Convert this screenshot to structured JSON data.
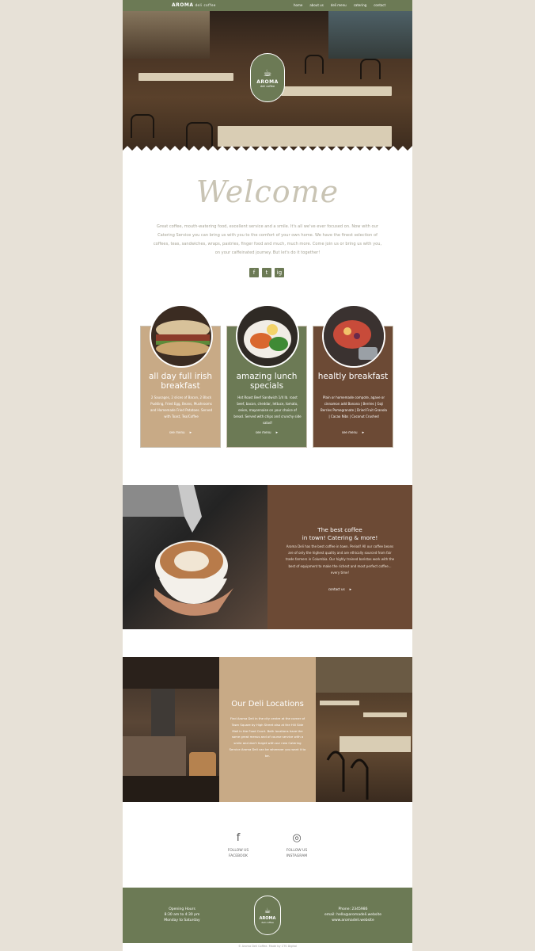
{
  "nav": {
    "brand": "AROMA",
    "brand_sub": "deli coffee",
    "links": [
      "home",
      "about us",
      "deli menu",
      "catering",
      "contact"
    ]
  },
  "hero": {
    "logo_name": "AROMA",
    "logo_sub": "deli coffee"
  },
  "welcome": {
    "title": "Welcome",
    "text": "Great coffee, mouth-watering food, excellent service and a smile. It's all we've ever focused on. Now with our Catering Service you can bring us with you to the comfort of your own home. We have the finest selection of coffees, teas, sandwiches, wraps, pastries, finger food and much, much more. Come join us or bring us with you, on your caffeinated journey. But let's do it together!",
    "social": [
      "f",
      "t",
      "ig"
    ]
  },
  "cards": [
    {
      "title": "all day full irish breakfast",
      "desc": "2 Sausages, 2 slices of Bacon, 2 Black Pudding, Fried Egg, Beans, Mushrooms and Homemade Fried Potatoes. Served with Toast, Tea/Coffee",
      "link": "see menu",
      "color": "#c8aa86"
    },
    {
      "title": "amazing lunch specials",
      "desc": "Hot Roast Beef Sandwich 1/4 lb. roast beef, bacon, cheddar, lettuce, tomato, onion, mayonnaise on your choice of bread. Served with chips and crunchy side salad!",
      "link": "see menu",
      "color": "#6c7a55"
    },
    {
      "title": "healtly breakfast",
      "desc": "Plain or homemade compote, agave or cinnamon add Banana | Berries | Goji Berries Pomegranate | Dried Fruit Granola | Cacao Nibs | Coconut Crushed",
      "link": "see menu",
      "color": "#6c4a35"
    }
  ],
  "coffee": {
    "title_line1": "The best coffee",
    "title_line2": "in town! Catering & more!",
    "text": "Aroma Deli has the best coffee in town. Period! All our coffee beans are of only the highest quality and are ethically sourced from fair trade farmers in Columbia. Our highly trained baristas work with the best of equipment to make the richest and most perfect coffee... every time!",
    "link": "contact us"
  },
  "locations": {
    "title": "Our Deli Locations",
    "text": "Find Aroma Deli in the city centre at the corner of Town Square by High Street also at the Hill Side Mall in the Food Court. Both locations have the same great menus and of course service with a smile and don't forget with our new Catering Service Aroma Deli can be wherever you want it to be."
  },
  "follow": [
    {
      "icon": "facebook-icon",
      "line1": "FOLLOW US",
      "line2": "FACEBOOK"
    },
    {
      "icon": "instagram-icon",
      "line1": "FOLLOW US",
      "line2": "INSTAGRAM"
    }
  ],
  "footer": {
    "hours_title": "Opening Hours",
    "hours_time": "8:30 am to 4:30 pm",
    "hours_days": "Monday to Saturday",
    "logo_name": "AROMA",
    "logo_sub": "deli coffee",
    "phone": "Phone: 2345986",
    "email": "email: hello@aromadeli.website",
    "website": "www.aromadeli.website",
    "copyright": "© Aroma Deli Coffee. Made by CTS Digital"
  },
  "colors": {
    "olive": "#6c7a55",
    "tan": "#c8aa86",
    "brown": "#6c4a35",
    "background": "#e7e1d7"
  }
}
